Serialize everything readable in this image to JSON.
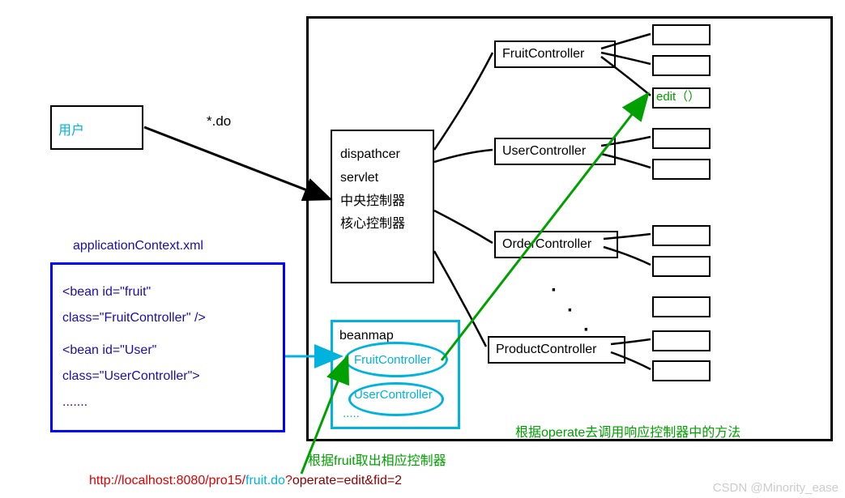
{
  "user": {
    "label": "用户"
  },
  "do_label": "*.do",
  "dispatcher": {
    "line1": "dispathcer",
    "line2": "servlet",
    "line3": "中央控制器",
    "line4": "核心控制器"
  },
  "controllers": {
    "fruit": "FruitController",
    "user": "UserController",
    "order": "OrderController",
    "product": "ProductController"
  },
  "edit_method": "edit（）",
  "beanmap": {
    "title": "beanmap",
    "item1": "FruitController",
    "item2": "UserController",
    "dots": "....."
  },
  "xml": {
    "title": "applicationContext.xml",
    "line1": "<bean id=\"fruit\"",
    "line2": "class=\"FruitController\" />",
    "line3": "<bean id=\"User\"",
    "line4": "class=\"UserController\">",
    "line5": "......."
  },
  "annotations": {
    "green1": "根据fruit取出相应控制器",
    "green2": "根据operate去调用响应控制器中的方法"
  },
  "url": {
    "part1": "http://localhost:8080/pro15/",
    "part2": "fruit.do",
    "part3": "?",
    "part4": "operate=edit&fid=2"
  },
  "watermark": "CSDN @Minority_ease",
  "dots": {
    "d1": "·",
    "d2": "·",
    "d3": "·"
  }
}
